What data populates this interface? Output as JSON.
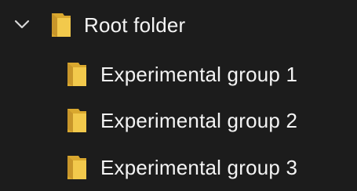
{
  "tree": {
    "root": {
      "label": "Root folder",
      "expanded": true,
      "icon": "folder-icon",
      "chevron_icon": "chevron-down-icon"
    },
    "children": [
      {
        "label": "Experimental group 1",
        "icon": "folder-icon"
      },
      {
        "label": "Experimental group 2",
        "icon": "folder-icon"
      },
      {
        "label": "Experimental group 3",
        "icon": "folder-icon"
      }
    ]
  },
  "colors": {
    "background": "#1c1c1c",
    "text": "#f4f4f4",
    "folder_front": "#f2c94c",
    "folder_back": "#d9a82f",
    "chevron": "#d8d8d8"
  }
}
